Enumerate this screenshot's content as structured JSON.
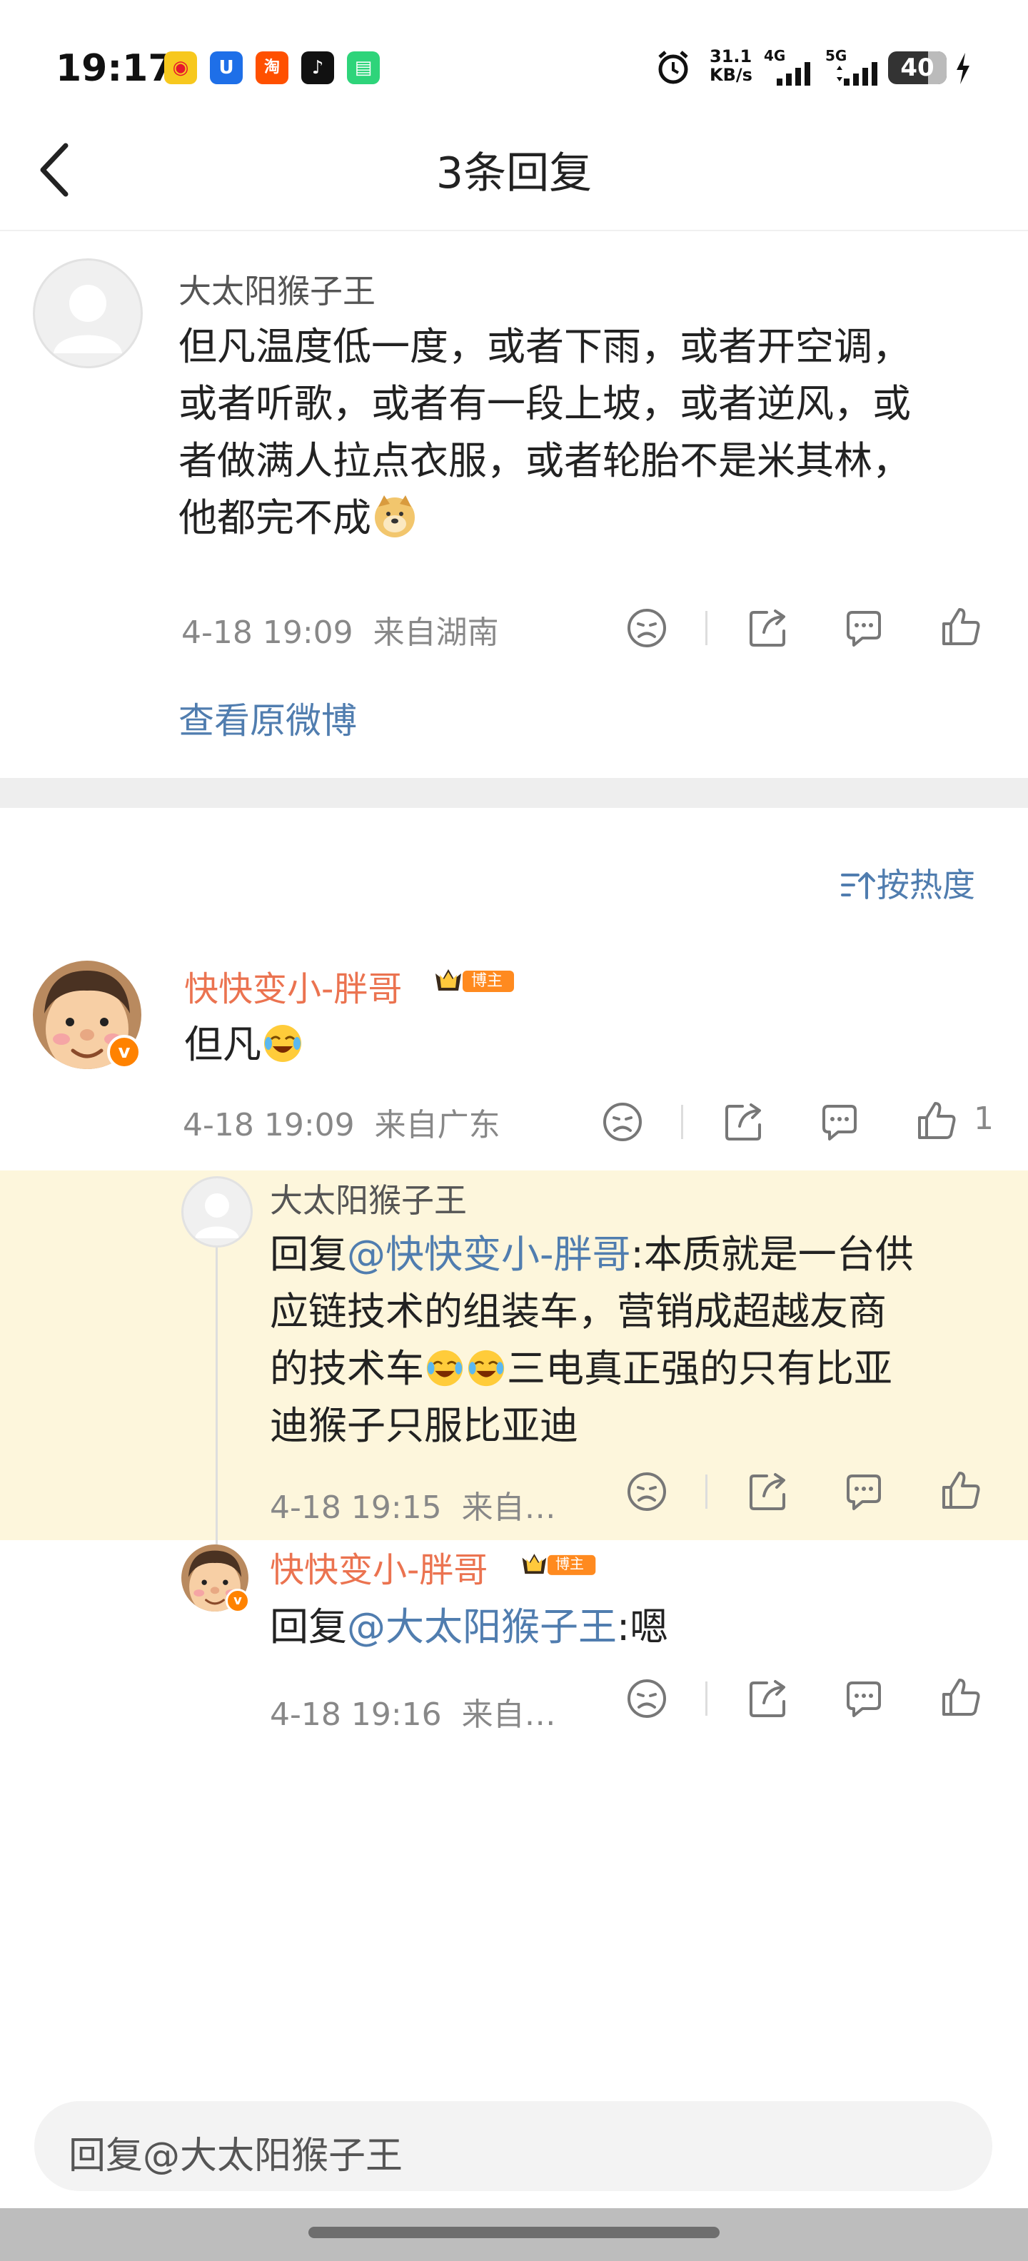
{
  "status_bar": {
    "time": "19:17",
    "net_speed_value": "31.1",
    "net_speed_unit": "KB/s",
    "sim1": "4G",
    "sim2": "5G",
    "battery": "40",
    "apps": [
      "weibo-icon",
      "uc-icon",
      "taobao-icon",
      "tiktok-icon",
      "messages-icon"
    ]
  },
  "header": {
    "title": "3条回复"
  },
  "original_comment": {
    "author": "大太阳猴子王",
    "lines": [
      "但凡温度低一度，或者下雨，或者开空调，",
      "或者听歌，或者有一段上坡，或者逆风，或",
      "者做满人拉点衣服，或者轮胎不是米其林，",
      "他都完不成"
    ],
    "emoji": "doge-emoji",
    "timestamp": "4-18 19:09",
    "location": "来自湖南",
    "view_original": "查看原微博"
  },
  "sort": {
    "label": "按热度"
  },
  "replies": [
    {
      "author": "快快变小-胖哥",
      "badge": "博主",
      "text": "但凡",
      "emoji": "laugh-cry-emoji",
      "timestamp": "4-18 19:09",
      "location": "来自广东",
      "like_count": "1"
    },
    {
      "author": "大太阳猴子王",
      "prefix": "回复",
      "mention": "@快快变小-胖哥",
      "lines": [
        ":本质就是一台供",
        "应链技术的组装车，营销成超越友商",
        "的技术车",
        "三电真正强的只有比亚",
        "迪猴子只服比亚迪"
      ],
      "timestamp": "4-18 19:15",
      "location": "来自…"
    },
    {
      "author": "快快变小-胖哥",
      "badge": "博主",
      "prefix": "回复",
      "mention": "@大太阳猴子王",
      "suffix": ":嗯",
      "timestamp": "4-18 19:16",
      "location": "来自…"
    }
  ],
  "composer": {
    "placeholder": "回复@大太阳猴子王"
  },
  "colors": {
    "accent_orange": "#eb7350",
    "link_blue": "#507daf",
    "highlight_bg": "#fdf6dc"
  }
}
